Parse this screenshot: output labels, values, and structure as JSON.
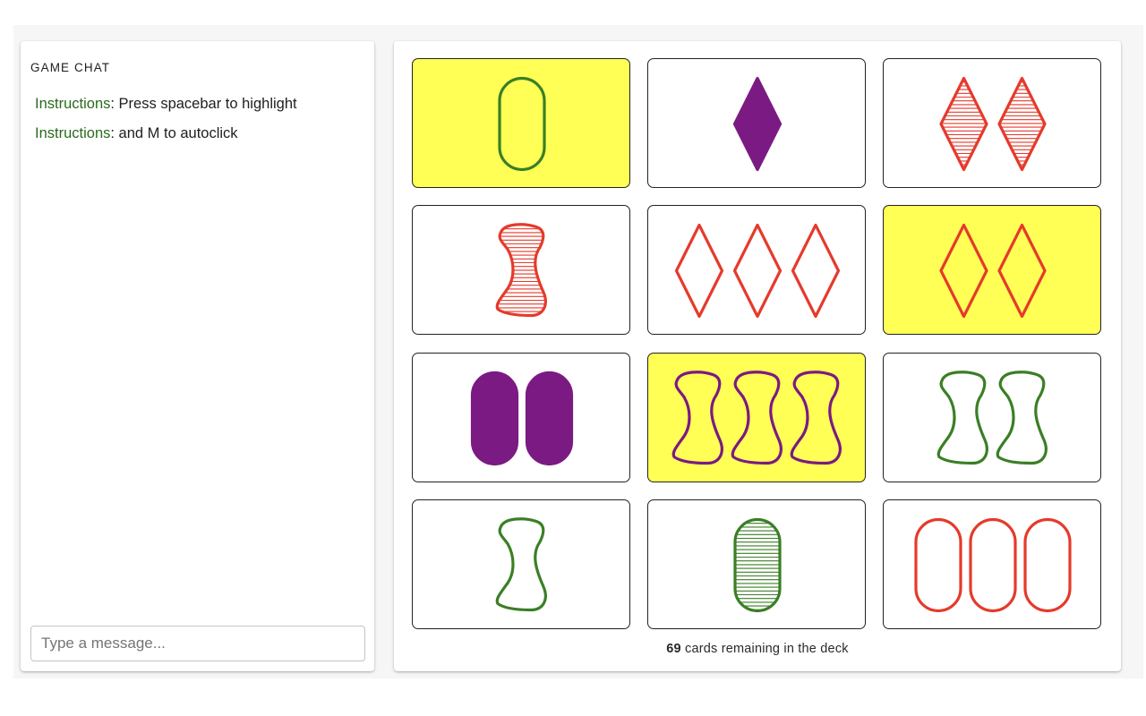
{
  "chat": {
    "title": "GAME CHAT",
    "messages": [
      {
        "user": "Instructions",
        "separator": ":",
        "text": " Press spacebar to highlight"
      },
      {
        "user": "Instructions",
        "separator": ":",
        "text": " and M to autoclick"
      }
    ],
    "input_placeholder": "Type a message..."
  },
  "board": {
    "deck_remaining": "69",
    "deck_suffix": " cards remaining in the deck",
    "colors": {
      "red": "#e53a2b",
      "green": "#3a7f25",
      "purple": "#7b1a82",
      "highlight": "#ffff55"
    },
    "cards": [
      {
        "count": 1,
        "shape": "oval",
        "color": "green",
        "fill": "outline",
        "selected": true
      },
      {
        "count": 1,
        "shape": "diamond",
        "color": "purple",
        "fill": "solid",
        "selected": false
      },
      {
        "count": 2,
        "shape": "diamond",
        "color": "red",
        "fill": "striped",
        "selected": false
      },
      {
        "count": 1,
        "shape": "squiggle",
        "color": "red",
        "fill": "striped",
        "selected": false
      },
      {
        "count": 3,
        "shape": "diamond",
        "color": "red",
        "fill": "outline",
        "selected": false
      },
      {
        "count": 2,
        "shape": "diamond",
        "color": "red",
        "fill": "outline",
        "selected": true
      },
      {
        "count": 2,
        "shape": "oval",
        "color": "purple",
        "fill": "solid",
        "selected": false
      },
      {
        "count": 3,
        "shape": "squiggle",
        "color": "purple",
        "fill": "outline",
        "selected": true
      },
      {
        "count": 2,
        "shape": "squiggle",
        "color": "green",
        "fill": "outline",
        "selected": false
      },
      {
        "count": 1,
        "shape": "squiggle",
        "color": "green",
        "fill": "outline",
        "selected": false
      },
      {
        "count": 1,
        "shape": "oval",
        "color": "green",
        "fill": "striped",
        "selected": false
      },
      {
        "count": 3,
        "shape": "oval",
        "color": "red",
        "fill": "outline",
        "selected": false
      }
    ]
  }
}
